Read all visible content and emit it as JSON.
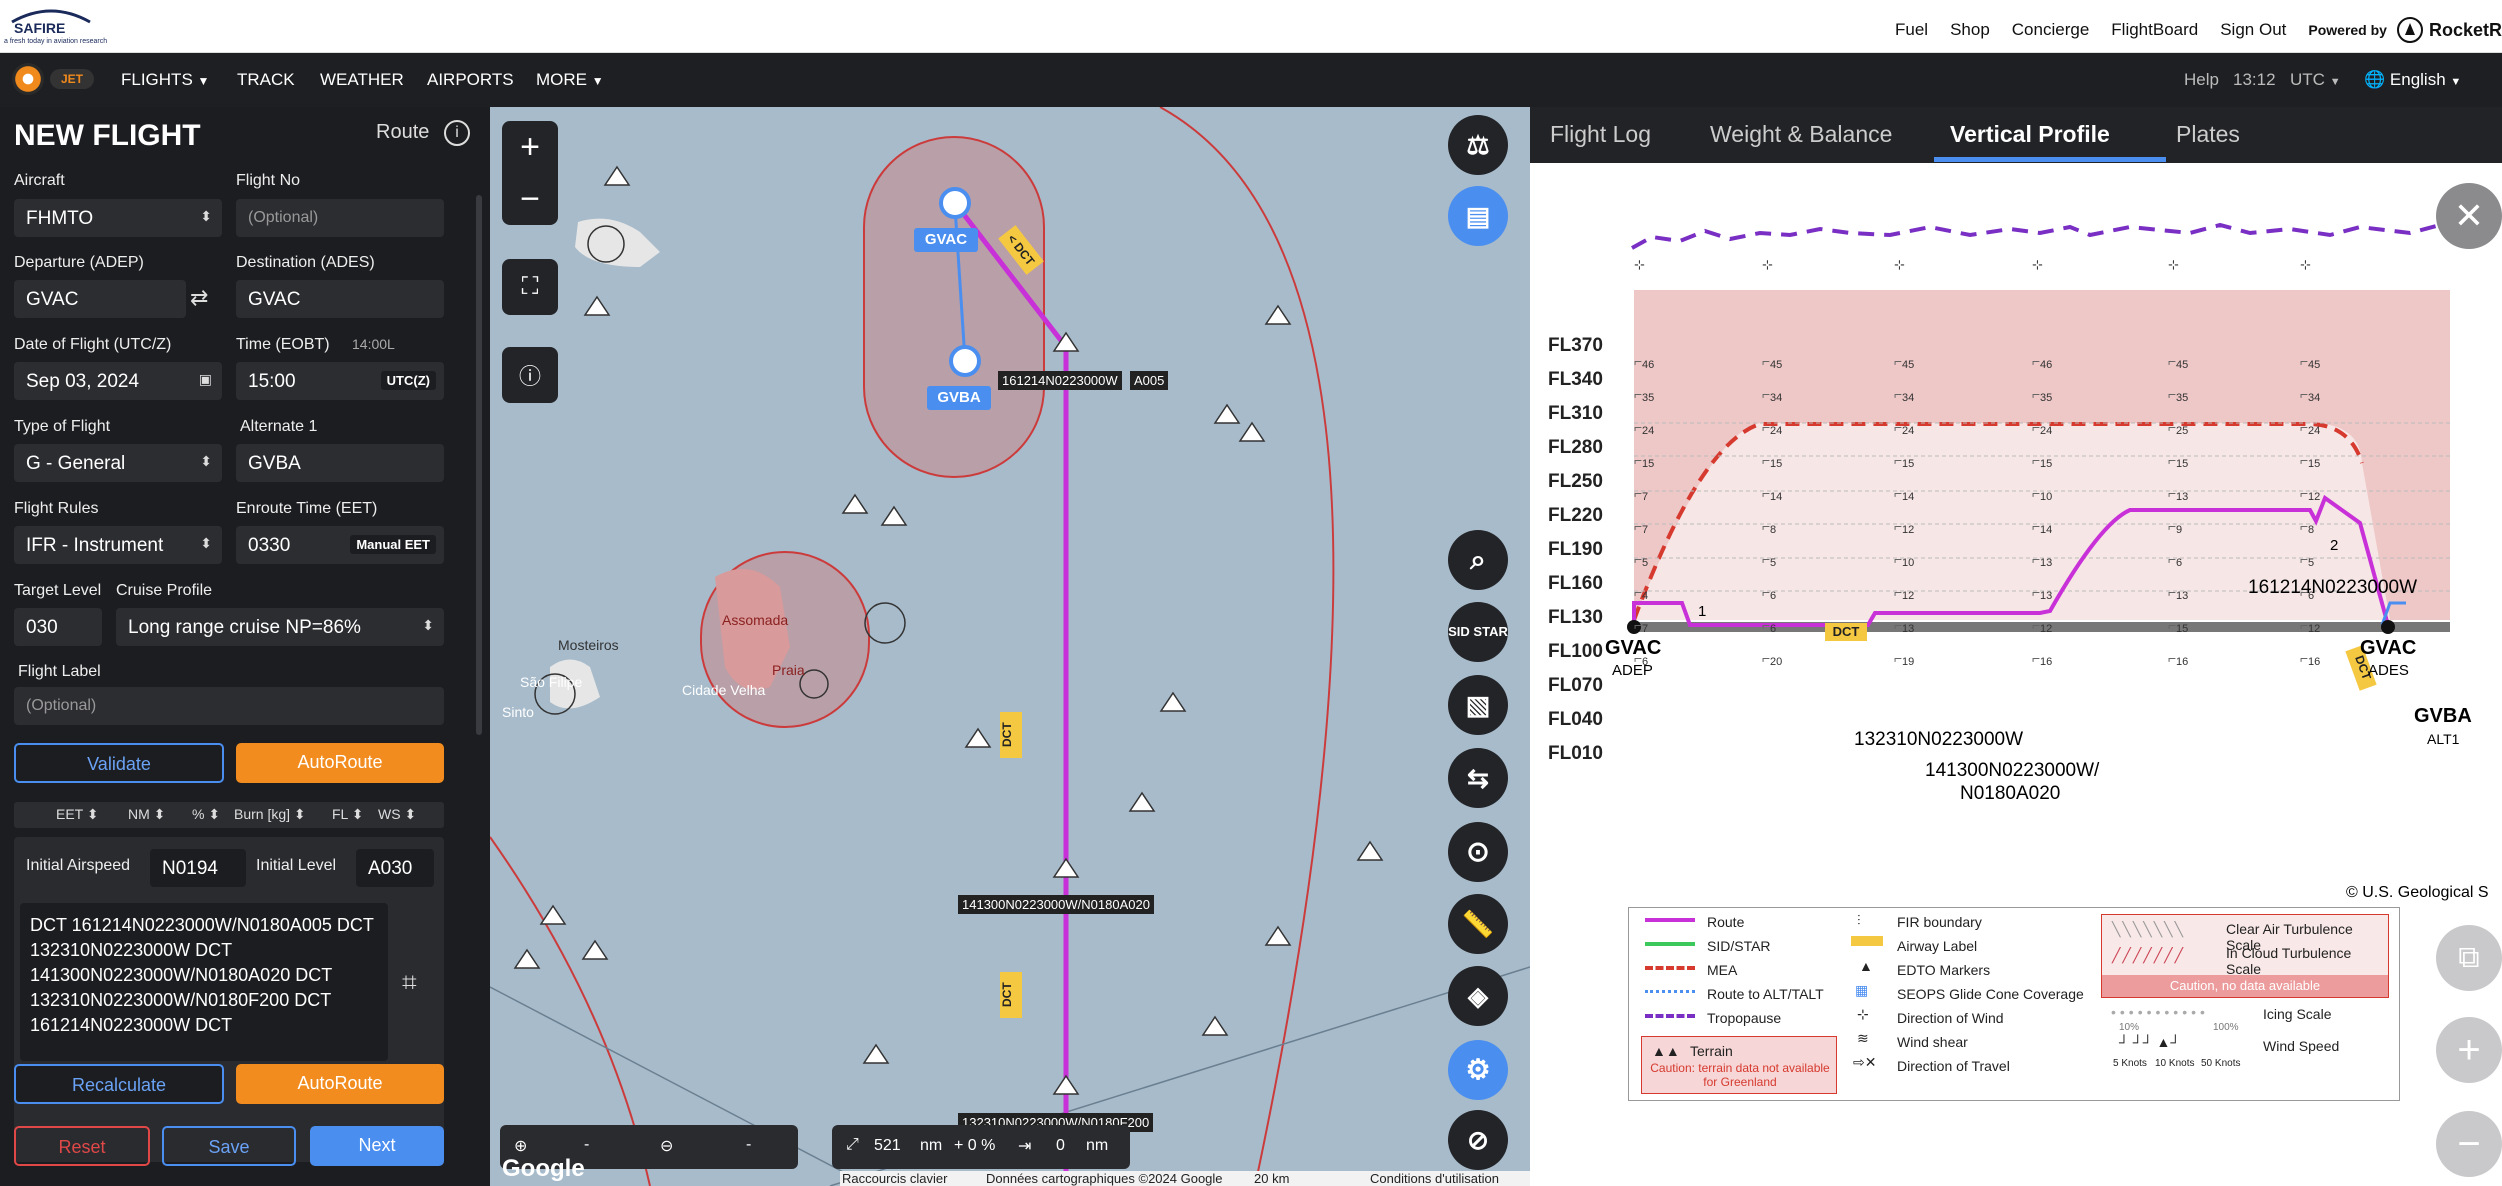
{
  "header": {
    "logo_text": "SAFIRE",
    "logo_tagline": "a fresh today in aviation research",
    "links": [
      "Fuel",
      "Shop",
      "Concierge",
      "FlightBoard",
      "Sign Out"
    ],
    "powered_by": "Powered by",
    "powered_brand": "RocketR"
  },
  "nav": {
    "logo_badge": "JET",
    "flights": "FLIGHTS",
    "track": "TRACK",
    "weather": "WEATHER",
    "airports": "AIRPORTS",
    "more": "MORE",
    "help": "Help",
    "time": "13:12",
    "tz": "UTC",
    "language": "English"
  },
  "form": {
    "title": "NEW FLIGHT",
    "route_label": "Route",
    "aircraft_label": "Aircraft",
    "aircraft": "FHMTO",
    "flightno_label": "Flight No",
    "flightno_placeholder": "(Optional)",
    "departure_label": "Departure (ADEP)",
    "departure": "GVAC",
    "destination_label": "Destination (ADES)",
    "destination": "GVAC",
    "date_label": "Date of Flight (UTC/Z)",
    "date": "Sep 03, 2024",
    "time_label": "Time (EOBT)",
    "time_local": "14:00L",
    "time": "15:00",
    "time_unit": "UTC(Z)",
    "type_label": "Type of Flight",
    "type": "G - General",
    "alternate_label": "Alternate 1",
    "alternate": "GVBA",
    "rules_label": "Flight Rules",
    "rules": "IFR - Instrument",
    "eet_label": "Enroute Time (EET)",
    "eet": "0330",
    "eet_mode": "Manual EET",
    "target_label": "Target Level",
    "target": "030",
    "cruise_label": "Cruise Profile",
    "cruise": "Long range cruise NP=86%",
    "flight_label_label": "Flight Label",
    "flight_label_placeholder": "(Optional)",
    "validate": "Validate",
    "autoroute": "AutoRoute",
    "columns": [
      "EET",
      "NM",
      "%",
      "Burn [kg]",
      "FL",
      "WS"
    ],
    "airspeed_label": "Initial Airspeed",
    "airspeed": "N0194",
    "level_label": "Initial Level",
    "level": "A030",
    "route_text": "DCT 161214N0223000W/N0180A005 DCT 132310N0223000W DCT 141300N0223000W/N0180A020 DCT 132310N0223000W/N0180F200 DCT 161214N0223000W DCT",
    "recalculate": "Recalculate",
    "autoroute2": "AutoRoute",
    "reset": "Reset",
    "save": "Save",
    "next": "Next"
  },
  "map": {
    "airports": [
      "GVAC",
      "GVBA"
    ],
    "airway": "DCT",
    "waypoints": [
      "161214N0223000W",
      "A005",
      "141300N0223000W/N0180A020",
      "132310N0223000W/N0180F200"
    ],
    "places": [
      "Assomada",
      "Praia",
      "Mosteiros",
      "São Filipe",
      "Cidade Velha",
      "Sinto"
    ],
    "bottom_bar": {
      "dist_value": "521",
      "dist_unit": "nm",
      "pct": "+ 0 %",
      "dev_value": "0",
      "dev_unit": "nm",
      "dash": "-"
    },
    "attribution": [
      "Raccourcis clavier",
      "Données cartographiques ©2024 Google",
      "20 km",
      "Conditions d'utilisation"
    ],
    "google": "Google",
    "sid_star": "SID STAR"
  },
  "profile": {
    "tabs": [
      "Flight Log",
      "Weight & Balance",
      "Vertical Profile",
      "Plates"
    ],
    "active_tab": "Vertical Profile",
    "flight_levels": [
      "FL370",
      "FL340",
      "FL310",
      "FL280",
      "FL250",
      "FL220",
      "FL190",
      "FL160",
      "FL130",
      "FL100",
      "FL070",
      "FL040",
      "FL010"
    ],
    "dep": "GVAC",
    "dep_sub": "ADEP",
    "arr": "GVAC",
    "arr_sub": "ADES",
    "alt": "GVBA",
    "alt_sub": "ALT1",
    "points": [
      "132310N0223000W",
      "141300N0223000W/",
      "N0180A020",
      "161214N0223000W"
    ],
    "wind_cols": [
      [
        "46",
        "35",
        "24",
        "15",
        "7",
        "7",
        "5",
        "4",
        "7",
        "6"
      ],
      [
        "45",
        "34",
        "24",
        "15",
        "14",
        "8",
        "5",
        "6",
        "6",
        "20"
      ],
      [
        "45",
        "34",
        "24",
        "15",
        "14",
        "12",
        "10",
        "12",
        "13",
        "19"
      ],
      [
        "46",
        "35",
        "24",
        "15",
        "10",
        "14",
        "13",
        "13",
        "12",
        "16"
      ],
      [
        "45",
        "35",
        "25",
        "15",
        "13",
        "9",
        "6",
        "13",
        "15",
        "16"
      ],
      [
        "45",
        "34",
        "24",
        "15",
        "12",
        "8",
        "5",
        "6",
        "12",
        "16"
      ]
    ],
    "markers": [
      "1",
      "2"
    ],
    "dct": "DCT",
    "geo_credit": "© U.S. Geological S",
    "legend": {
      "route": "Route",
      "sidstar": "SID/STAR",
      "mea": "MEA",
      "alt_route": "Route to ALT/TALT",
      "tropopause": "Tropopause",
      "terrain": "Terrain",
      "terrain_caution": "Caution: terrain data not available for Greenland",
      "fir": "FIR boundary",
      "airway": "Airway Label",
      "edto": "EDTO Markers",
      "seops": "SEOPS Glide Cone Coverage",
      "wind_dir": "Direction of Wind",
      "wind_shear": "Wind shear",
      "travel_dir": "Direction of Travel",
      "cat": "Clear Air Turbulence Scale",
      "ict": "In Cloud Turbulence Scale",
      "turb_caution": "Caution, no data available",
      "icing": "Icing Scale",
      "icing_lo": "10%",
      "icing_hi": "100%",
      "wind_speed": "Wind Speed",
      "knots": [
        "5 Knots",
        "10 Knots",
        "50 Knots"
      ]
    }
  },
  "colors": {
    "accent": "#f28c1e",
    "route": "#c831d8",
    "mea": "#d63a2f",
    "tropopause": "#7a2fc4",
    "blue_btn": "#4a8ef0",
    "reset_red": "#e04848"
  }
}
